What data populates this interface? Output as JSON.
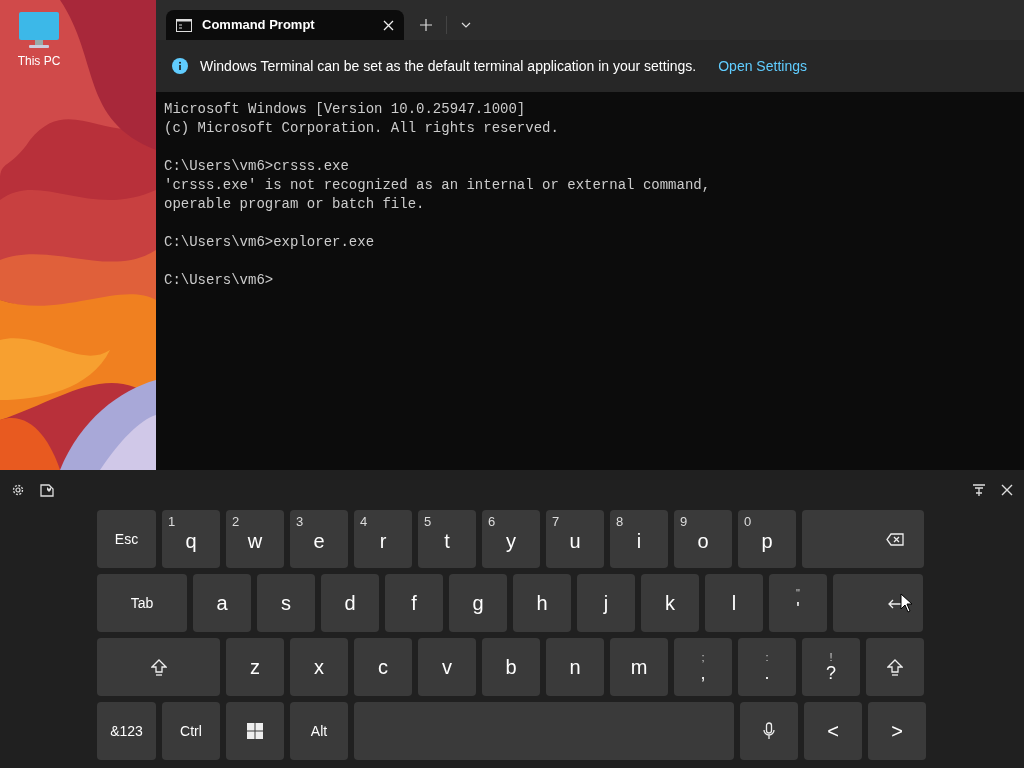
{
  "desktop": {
    "icons": [
      {
        "label": "This PC"
      }
    ]
  },
  "terminal": {
    "tabs": [
      {
        "title": "Command Prompt",
        "selected": true
      }
    ],
    "infobar": {
      "message": "Windows Terminal can be set as the default terminal application in your settings.",
      "link": "Open Settings"
    },
    "blocks": [
      [
        "Microsoft Windows [Version 10.0.25947.1000]",
        "(c) Microsoft Corporation. All rights reserved."
      ],
      [
        "C:\\Users\\vm6>crsss.exe",
        "'crsss.exe' is not recognized as an internal or external command,",
        "operable program or batch file."
      ],
      [
        "C:\\Users\\vm6>explorer.exe"
      ],
      [
        "C:\\Users\\vm6>"
      ]
    ]
  },
  "keyboard": {
    "key_lines": [
      {
        "keys": [
          {
            "kind": "text",
            "label": "Esc"
          },
          {
            "kind": "letter",
            "label": "q",
            "hint": "1"
          },
          {
            "kind": "letter",
            "label": "w",
            "hint": "2"
          },
          {
            "kind": "letter",
            "label": "e",
            "hint": "3"
          },
          {
            "kind": "letter",
            "label": "r",
            "hint": "4"
          },
          {
            "kind": "letter",
            "label": "t",
            "hint": "5"
          },
          {
            "kind": "letter",
            "label": "y",
            "hint": "6"
          },
          {
            "kind": "letter",
            "label": "u",
            "hint": "7"
          },
          {
            "kind": "letter",
            "label": "i",
            "hint": "8"
          },
          {
            "kind": "letter",
            "label": "o",
            "hint": "9"
          },
          {
            "kind": "letter",
            "label": "p",
            "hint": "0"
          },
          {
            "kind": "backspace"
          }
        ]
      },
      {
        "keys": [
          {
            "kind": "text",
            "label": "Tab"
          },
          {
            "kind": "letter",
            "label": "a"
          },
          {
            "kind": "letter",
            "label": "s"
          },
          {
            "kind": "letter",
            "label": "d"
          },
          {
            "kind": "letter",
            "label": "f"
          },
          {
            "kind": "letter",
            "label": "g"
          },
          {
            "kind": "letter",
            "label": "h"
          },
          {
            "kind": "letter",
            "label": "j"
          },
          {
            "kind": "letter",
            "label": "k"
          },
          {
            "kind": "letter",
            "label": "l"
          },
          {
            "kind": "symbol",
            "label": "'",
            "hint": "\""
          },
          {
            "kind": "enter"
          }
        ]
      },
      {
        "keys": [
          {
            "kind": "shift"
          },
          {
            "kind": "letter",
            "label": "z"
          },
          {
            "kind": "letter",
            "label": "x"
          },
          {
            "kind": "letter",
            "label": "c"
          },
          {
            "kind": "letter",
            "label": "v"
          },
          {
            "kind": "letter",
            "label": "b"
          },
          {
            "kind": "letter",
            "label": "n"
          },
          {
            "kind": "letter",
            "label": "m"
          },
          {
            "kind": "symbol",
            "label": ",",
            "hint": ";"
          },
          {
            "kind": "symbol",
            "label": ".",
            "hint": ":"
          },
          {
            "kind": "symbol",
            "label": "?",
            "hint": "!"
          },
          {
            "kind": "shift"
          }
        ]
      },
      {
        "keys": [
          {
            "kind": "text",
            "label": "&123"
          },
          {
            "kind": "text",
            "label": "Ctrl"
          },
          {
            "kind": "windows"
          },
          {
            "kind": "text",
            "label": "Alt"
          },
          {
            "kind": "space"
          },
          {
            "kind": "mic"
          },
          {
            "kind": "letter",
            "label": "<"
          },
          {
            "kind": "letter",
            "label": ">"
          }
        ]
      }
    ]
  }
}
